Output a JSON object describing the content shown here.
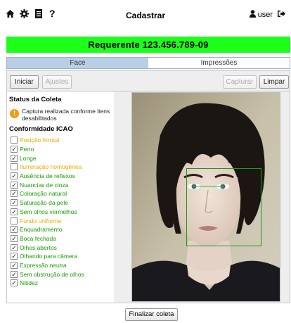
{
  "topbar": {
    "title": "Cadastrar",
    "icons": [
      "home-icon",
      "gear-icon",
      "document-icon",
      "help-icon"
    ],
    "help_glyph": "?",
    "user_label": "user",
    "user_icon": "user-icon",
    "logout_icon": "logout-icon"
  },
  "banner": {
    "text": "Requerente  123.456.789-09",
    "color": "#1bff1b"
  },
  "tabs": [
    {
      "label": "Face",
      "active": true
    },
    {
      "label": "Impressões",
      "active": false
    }
  ],
  "toolbar": {
    "iniciar": "Iniciar",
    "ajustes": "Ajustes",
    "capturar": "Capturar",
    "limpar": "Limpar"
  },
  "status": {
    "title": "Status da Coleta",
    "icon": "warning-icon",
    "icon_glyph": "!",
    "message": "Captura realizada conforme itens desabilitados"
  },
  "icao": {
    "title": "Conformidade ICAO",
    "ok_color": "#15a000",
    "fail_color": "#f0a800",
    "items": [
      {
        "label": "Posição frontal",
        "checked": false
      },
      {
        "label": "Perto",
        "checked": true
      },
      {
        "label": "Longe",
        "checked": true
      },
      {
        "label": "Iluminação homogênea",
        "checked": false
      },
      {
        "label": "Ausência de reflexos",
        "checked": true
      },
      {
        "label": "Nuancias de cinza",
        "checked": true
      },
      {
        "label": "Coloração natural",
        "checked": true
      },
      {
        "label": "Saturação da pele",
        "checked": true
      },
      {
        "label": "Sem olhos vermelhos",
        "checked": true
      },
      {
        "label": "Fundo uniforme",
        "checked": false
      },
      {
        "label": "Enquadramento",
        "checked": true
      },
      {
        "label": "Boca fechada",
        "checked": true
      },
      {
        "label": "Olhos abertos",
        "checked": true
      },
      {
        "label": "Olhando para câmera",
        "checked": true
      },
      {
        "label": "Expressão neutra",
        "checked": true
      },
      {
        "label": "Sem obstrução de olhos",
        "checked": true
      },
      {
        "label": "Nitidez",
        "checked": true
      }
    ]
  },
  "footer": {
    "finalize": "Finalizar coleta"
  }
}
